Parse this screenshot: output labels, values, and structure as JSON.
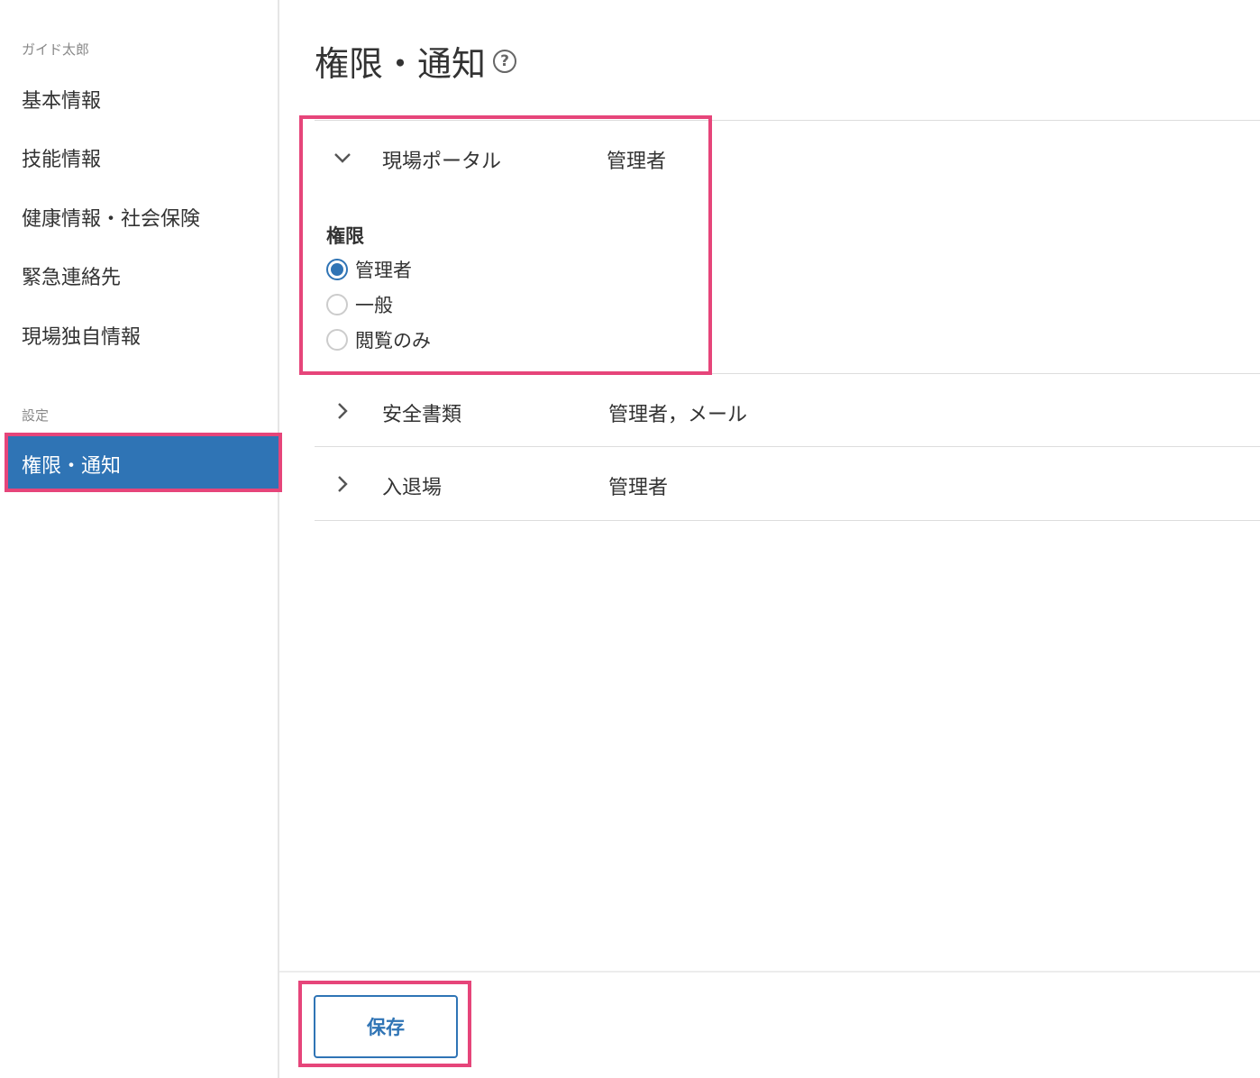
{
  "sidebar": {
    "user_caption": "ガイド太郎",
    "items": [
      {
        "label": "基本情報"
      },
      {
        "label": "技能情報"
      },
      {
        "label": "健康情報・社会保険"
      },
      {
        "label": "緊急連絡先"
      },
      {
        "label": "現場独自情報"
      }
    ],
    "settings_caption": "設定",
    "active_item": {
      "label": "権限・通知"
    }
  },
  "main": {
    "title": "権限・通知",
    "help_icon": "question-circle-icon",
    "sections": [
      {
        "name": "現場ポータル",
        "value": "管理者",
        "expanded": true
      },
      {
        "name": "安全書類",
        "value": "管理者，メール",
        "expanded": false
      },
      {
        "name": "入退場",
        "value": "管理者",
        "expanded": false
      }
    ],
    "permission": {
      "label": "権限",
      "options": [
        {
          "label": "管理者",
          "checked": true
        },
        {
          "label": "一般",
          "checked": false
        },
        {
          "label": "閲覧のみ",
          "checked": false
        }
      ]
    }
  },
  "footer": {
    "save_label": "保存"
  },
  "colors": {
    "accent": "#2f74b5",
    "highlight": "#e6457a"
  }
}
